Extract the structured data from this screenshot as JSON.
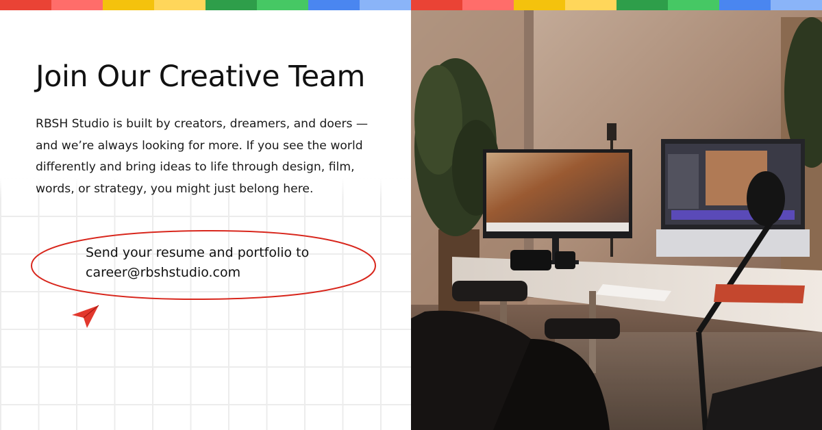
{
  "colors": {
    "strip": [
      "#ea4335",
      "#ff6d6a",
      "#f4c20d",
      "#ffd65a",
      "#2e9e4a",
      "#46c864",
      "#4a86f0",
      "#8ab4f8",
      "#ea4335",
      "#ff6d6a",
      "#f4c20d",
      "#ffd65a",
      "#2e9e4a",
      "#46c864",
      "#4a86f0",
      "#8ab4f8"
    ],
    "accent": "#d8261c"
  },
  "header": {
    "title": "Join Our Creative Team"
  },
  "intro": {
    "text": "RBSH Studio is built by creators, dreamers, and doers — and we’re always looking for more. If you see the world differently and bring ideas to life through design, film, words, or strategy, you might just belong here."
  },
  "cta": {
    "line1": "Send your resume and portfolio to",
    "email": "career@rbshstudio.com"
  },
  "icons": {
    "send": "paper-plane-icon"
  }
}
